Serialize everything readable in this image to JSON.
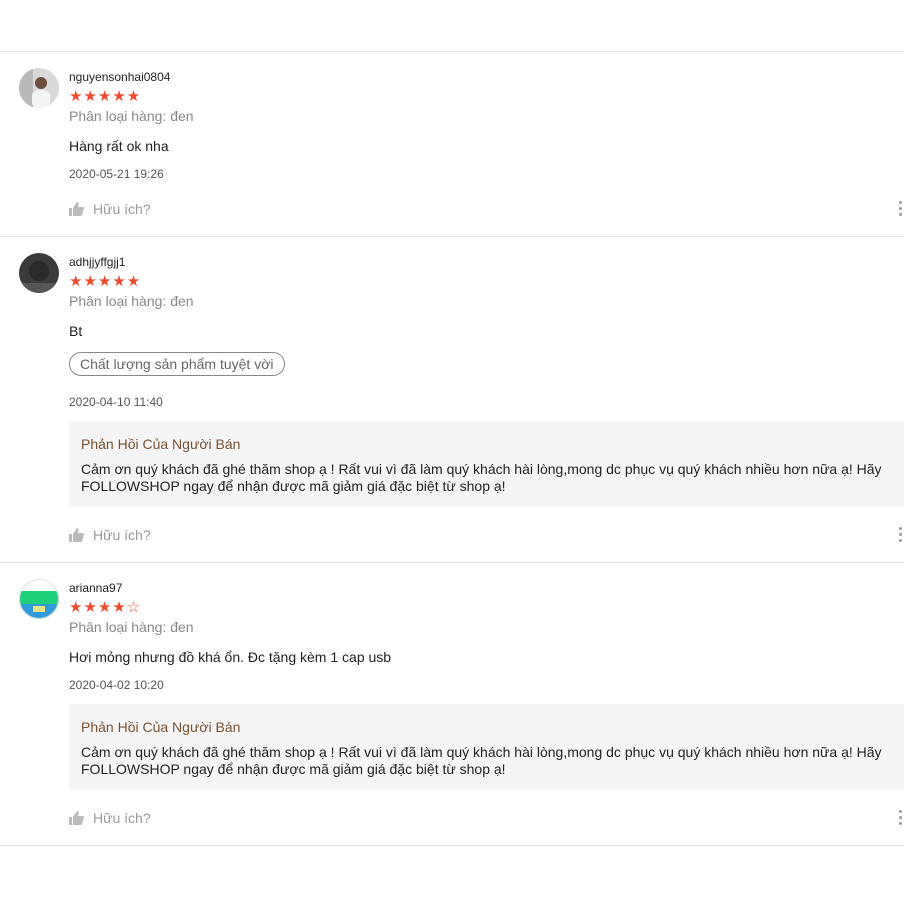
{
  "reviews": [
    {
      "username": "nguyensonhai0804",
      "rating": 5,
      "stars_text": "★★★★★",
      "variation": "Phân loại hàng: đen",
      "comment": "Hàng rất ok nha",
      "date": "2020-05-21 19:26",
      "helpful_label": "Hữu ích?"
    },
    {
      "username": "adhjjyffgjj1",
      "rating": 5,
      "stars_text": "★★★★★",
      "variation": "Phân loại hàng: đen",
      "comment": "Bt",
      "tag": "Chất lượng sản phẩm tuyệt vời",
      "date": "2020-04-10 11:40",
      "reply": {
        "title": "Phản Hồi Của Người Bán",
        "text": "Cảm ơn quý khách đã ghé thăm shop ạ ! Rất vui vì đã làm quý khách hài lòng,mong dc phục vụ quý khách nhiều hơn nữa ạ! Hãy FOLLOWSHOP ngay để nhận được mã giảm giá đặc biệt từ shop ạ!"
      },
      "helpful_label": "Hữu ích?"
    },
    {
      "username": "arianna97",
      "rating": 4,
      "stars_text": "★★★★☆",
      "variation": "Phân loại hàng: đen",
      "comment": "Hơi mỏng nhưng đồ khá ổn. Đc tặng kèm 1 cap usb",
      "date": "2020-04-02 10:20",
      "reply": {
        "title": "Phản Hồi Của Người Bán",
        "text": "Cảm ơn quý khách đã ghé thăm shop ạ ! Rất vui vì đã làm quý khách hài lòng,mong dc phục vụ quý khách nhiều hơn nữa ạ! Hãy FOLLOWSHOP ngay để nhận được mã giảm giá đặc biệt từ shop ạ!"
      },
      "helpful_label": "Hữu ích?"
    }
  ],
  "colors": {
    "star": "#ee4d2d",
    "reply_title": "#7a5230",
    "reply_bg": "#f5f5f5"
  }
}
